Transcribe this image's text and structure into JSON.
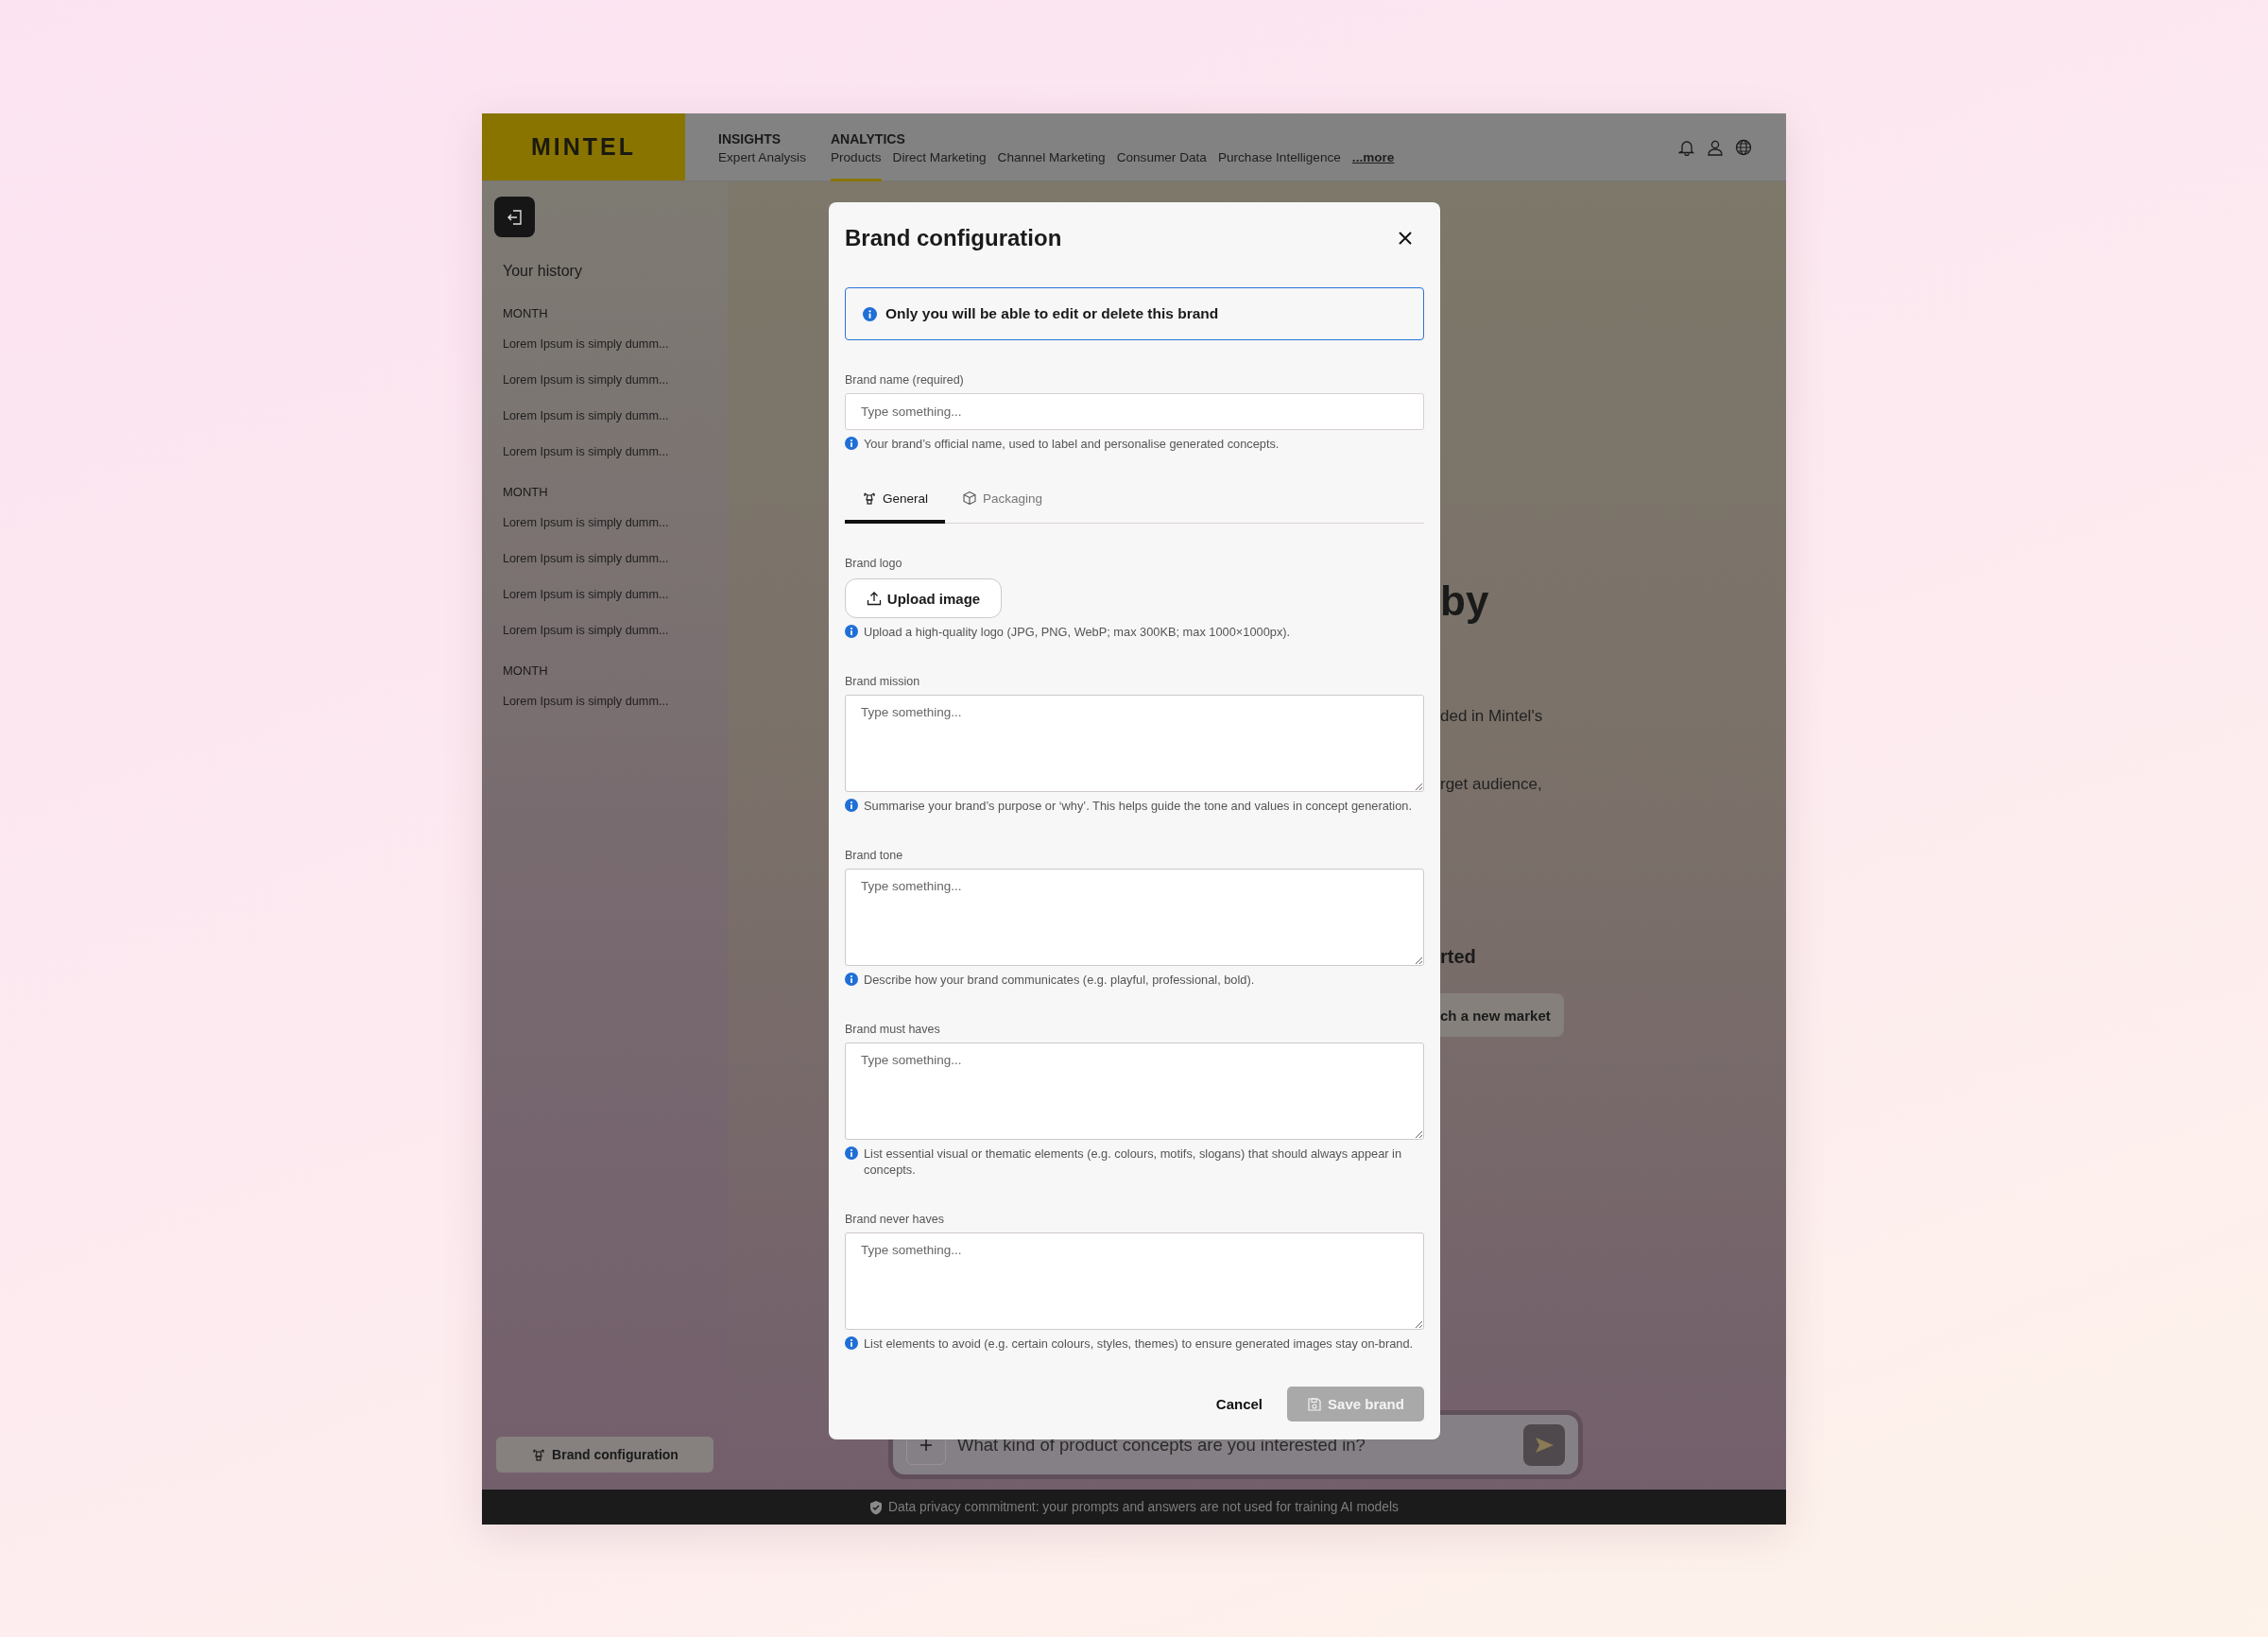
{
  "nav": {
    "logo": "MINTEL",
    "groups": [
      {
        "title": "INSIGHTS",
        "items": [
          {
            "label": "Expert Analysis",
            "selected": false
          }
        ]
      },
      {
        "title": "ANALYTICS",
        "items": [
          {
            "label": "Products",
            "selected": true
          },
          {
            "label": "Direct Marketing",
            "selected": false
          },
          {
            "label": "Channel Marketing",
            "selected": false
          },
          {
            "label": "Consumer Data",
            "selected": false
          },
          {
            "label": "Purchase Intelligence",
            "selected": false
          }
        ]
      }
    ],
    "more": "...more"
  },
  "sidebar": {
    "title": "Your history",
    "sections": [
      {
        "heading": "MONTH",
        "items": [
          "Lorem Ipsum is simply dumm...",
          "Lorem Ipsum is simply dumm...",
          "Lorem Ipsum is simply dumm...",
          "Lorem Ipsum is simply dumm..."
        ]
      },
      {
        "heading": "MONTH",
        "items": [
          "Lorem Ipsum is simply dumm...",
          "Lorem Ipsum is simply dumm...",
          "Lorem Ipsum is simply dumm...",
          "Lorem Ipsum is simply dumm..."
        ]
      },
      {
        "heading": "MONTH",
        "items": [
          "Lorem Ipsum is simply dumm..."
        ]
      }
    ],
    "brand_button": "Brand configuration"
  },
  "main": {
    "heading": "by",
    "paragraphs": [
      "ded in Mintel's",
      "rget audience,"
    ],
    "subheading": "rted",
    "suggestion": "ch a new market",
    "chat": {
      "placeholder": "What kind of product concepts are you interested in?"
    }
  },
  "footer": "Data privacy commitment: your prompts and answers are not used for training AI models",
  "modal": {
    "title": "Brand configuration",
    "notice": "Only you will be able to edit or delete this brand",
    "name_field": {
      "label": "Brand name (required)",
      "placeholder": "Type something...",
      "hint": "Your brand’s official name, used to label and personalise generated concepts."
    },
    "tabs": [
      {
        "label": "General",
        "selected": true
      },
      {
        "label": "Packaging",
        "selected": false
      }
    ],
    "fields": [
      {
        "kind": "upload",
        "label": "Brand logo",
        "button": "Upload image",
        "hint": "Upload a high-quality logo (JPG, PNG, WebP; max 300KB; max 1000×1000px)."
      },
      {
        "kind": "textarea",
        "label": "Brand mission",
        "placeholder": "Type something...",
        "hint": "Summarise your brand’s purpose or ‘why’. This helps guide the tone and values in concept generation."
      },
      {
        "kind": "textarea",
        "label": "Brand tone",
        "placeholder": "Type something...",
        "hint": "Describe how your brand communicates (e.g. playful, professional, bold)."
      },
      {
        "kind": "textarea",
        "label": "Brand must haves",
        "placeholder": "Type something...",
        "hint": "List essential visual or thematic elements (e.g. colours, motifs, slogans) that should always appear in concepts."
      },
      {
        "kind": "textarea",
        "label": "Brand never haves",
        "placeholder": "Type something...",
        "hint": "List elements to avoid (e.g. certain colours, styles, themes) to ensure generated images stay on-brand."
      }
    ],
    "cancel": "Cancel",
    "save": {
      "label": "Save brand",
      "disabled": true
    }
  }
}
